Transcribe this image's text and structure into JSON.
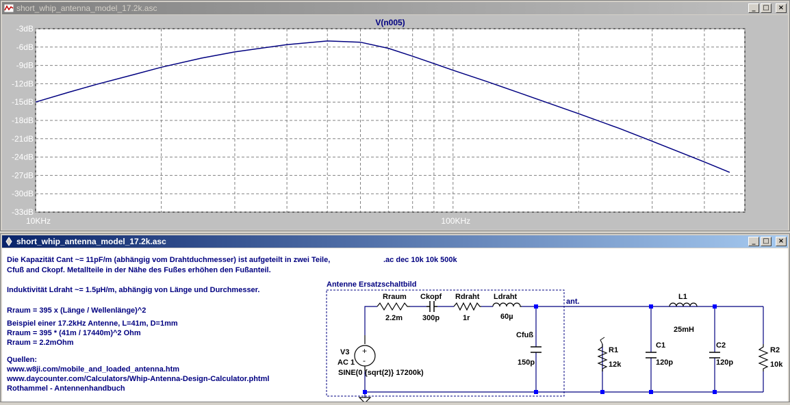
{
  "plot_window": {
    "title": "short_whip_antenna_model_17.2k.asc",
    "buttons": {
      "minimize": "_",
      "maximize": "□",
      "close": "×"
    }
  },
  "schematic_window": {
    "title": "short_whip_antenna_model_17.2k.asc",
    "buttons": {
      "minimize": "_",
      "maximize": "□",
      "close": "×"
    }
  },
  "chart_data": {
    "type": "line",
    "title": "V(n005)",
    "xscale": "log",
    "xlim": [
      10000,
      500000
    ],
    "ylim": [
      -33,
      -3
    ],
    "ylabel_ticks": [
      "-3dB",
      "-6dB",
      "-9dB",
      "-12dB",
      "-15dB",
      "-18dB",
      "-21dB",
      "-24dB",
      "-27dB",
      "-30dB",
      "-33dB"
    ],
    "yticks": [
      -3,
      -6,
      -9,
      -12,
      -15,
      -18,
      -21,
      -24,
      -27,
      -30,
      -33
    ],
    "xticks": [
      10000,
      100000
    ],
    "xtick_labels": [
      "10KHz",
      "100KHz"
    ],
    "grid": true,
    "line_color": "#000080",
    "series": [
      {
        "x": [
          10000,
          12000,
          14000,
          17200,
          20000,
          25000,
          30000,
          40000,
          50000,
          60000,
          70000,
          80000,
          90000,
          100000,
          120000,
          150000,
          200000,
          250000,
          300000,
          400000,
          460000
        ],
        "values": [
          -15.0,
          -13.4,
          -12.1,
          -10.5,
          -9.3,
          -7.8,
          -6.8,
          -5.6,
          -5.0,
          -5.2,
          -6.2,
          -7.5,
          -8.7,
          -9.8,
          -11.6,
          -13.9,
          -16.9,
          -19.3,
          -21.4,
          -24.8,
          -26.5
        ]
      }
    ]
  },
  "schematic": {
    "notes": [
      "Die Kapazität Cant ~= 11pF/m (abhängig vom Drahtduchmesser) ist aufgeteilt in zwei Teile,",
      "Cfuß and Ckopf. Metallteile in der Nähe des Fußes erhöhen den Fußanteil.",
      "Induktivität Ldraht ~= 1.5µH/m, abhängig von Länge und Durchmesser.",
      "Rraum = 395 x (Länge / Wellenlänge)^2",
      "Beispiel einer 17.2kHz Antenne, L=41m, D=1mm",
      "Rraum = 395 * (41m / 17440m)^2 Ohm",
      "Rraum = 2.2mOhm",
      "Quellen:",
      "www.w8ji.com/mobile_and_loaded_antenna.htm",
      "www.daycounter.com/Calculators/Whip-Antenna-Design-Calculator.phtml",
      "Rothammel - Antennenhandbuch"
    ],
    "directive": ".ac dec 10k 10k 500k",
    "box_title": "Antenne Ersatzschaltbild",
    "net_label": "ant.",
    "source": {
      "name": "V3",
      "value": "AC 1",
      "sine": "SINE(0 {sqrt(2)} 17200k)"
    },
    "components": {
      "rraum": {
        "name": "Rraum",
        "value": "2.2m"
      },
      "ckopf": {
        "name": "Ckopf",
        "value": "300p"
      },
      "rdraht": {
        "name": "Rdraht",
        "value": "1r"
      },
      "ldraht": {
        "name": "Ldraht",
        "value": "60µ"
      },
      "cfuss": {
        "name": "Cfuß",
        "value": "150p"
      },
      "r1": {
        "name": "R1",
        "value": "12k"
      },
      "c1": {
        "name": "C1",
        "value": "120p"
      },
      "l1": {
        "name": "L1",
        "value": "25mH"
      },
      "c2": {
        "name": "C2",
        "value": "120p"
      },
      "r2": {
        "name": "R2",
        "value": "10k"
      }
    },
    "colors": {
      "text": "#000080",
      "wire": "#000080",
      "node": "#0000ff",
      "component": "#000000"
    }
  }
}
